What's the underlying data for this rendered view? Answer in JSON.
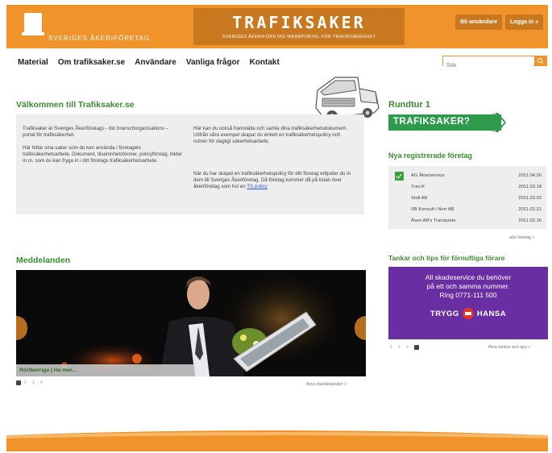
{
  "header": {
    "logo_text": "SVERIGES ÅKERIFÖRETAG",
    "brand_title": "TRAFIKSAKER",
    "brand_subtitle": "SVERIGES ÅKERIFÖRETAG WEBBPORTAL FÖR TRAFIKSÄKERHET",
    "bli_anvandare": "Bli användare",
    "logga_in": "Logga in »",
    "accent": "#f0932a",
    "accent_dark": "#c9781f"
  },
  "nav": {
    "items": [
      "Material",
      "Om trafiksaker.se",
      "Användare",
      "Vanliga frågor",
      "Kontakt"
    ]
  },
  "search": {
    "placeholder": "Sök"
  },
  "welcome": {
    "title": "Välkommen till Trafiksaker.se",
    "col1_p1": "Trafiksaker är Sveriges Åkeriföretags - din branschorganisations – portal för trafiksäkerhet.",
    "col1_p2": "Här hittar sina saker som du kan använda i företagets trafiksäkerhetsarbete. Dokument, tilsamnhetsformer, policyförslag, bilder m.m. som du kan fryga in i ditt företags trafiksäkerhetsarbete.",
    "col2_p1": "Här kan du också framställa och samla dina trafiksäkerhetsdokument. Utifrån våra exempel skapar du enkelt en trafiksäkerhetspolicy och rutiner för dagligt säkerhetsarbete.",
    "col2_p2": "När du har skapat en trafiksäkerhetspolicy för ditt företag erbjuder du in dem till Sveriges Åkeriföretag. Då företag kommer då på listan över åkeriföretag som hol en",
    "col2_link": "TS policy"
  },
  "rundtur": {
    "title": "Rundtur 1",
    "button": "TRAFIKSAKER?",
    "color": "#2e9a4c"
  },
  "companies": {
    "title": "Nya registrerade företag",
    "rows": [
      {
        "name": "AG Åkeriservice",
        "date": "2011.04.26"
      },
      {
        "name": "Trav-K",
        "date": "2011.03.18"
      },
      {
        "name": "Stoll AB",
        "date": "2011.03.03"
      },
      {
        "name": "SB Konsult i Norr AB",
        "date": "2011.02.21"
      },
      {
        "name": "Åsen AB's Transporte",
        "date": "2011.02.16"
      }
    ],
    "more": "alla företag »"
  },
  "messages": {
    "title": "Meddelanden",
    "caption_label": "Rörtberriga | ",
    "caption_link": "Ha mer...",
    "more": "flera meddelanden »",
    "pages": [
      "1",
      "2",
      "3",
      "4"
    ]
  },
  "tips": {
    "title": "Tankar och tips för förnuftiga förare",
    "ad_line1": "All skadeservice du behöver",
    "ad_line2": "på ett och samma nummer.",
    "ad_line3": "Ring 0771-111 500",
    "ad_brand_left": "TRYGG",
    "ad_brand_right": "HANSA",
    "ad_color": "#6a2ea3",
    "more": "flera tankar och tips »",
    "pages": [
      "1",
      "2",
      "3",
      "4"
    ]
  }
}
